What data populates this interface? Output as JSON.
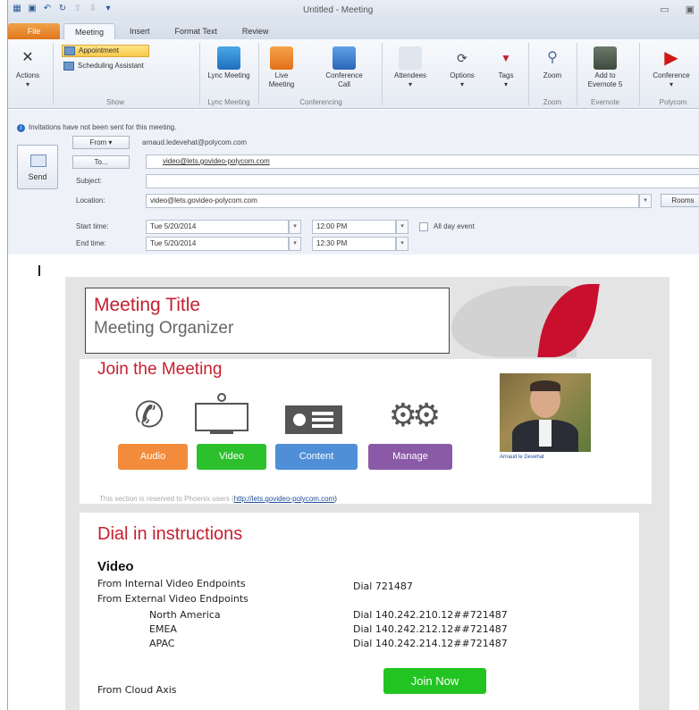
{
  "window": {
    "title": "Untitled - Meeting"
  },
  "tabs": [
    "File",
    "Meeting",
    "Insert",
    "Format Text",
    "Review"
  ],
  "ribbon": {
    "actions_label": "Actions",
    "appointment_label": "Appointment",
    "scheduling_label": "Scheduling Assistant",
    "show_group": "Show",
    "lync_meeting_label": "Lync Meeting",
    "lync_group": "Lync Meeting",
    "live_meeting_label": "Live Meeting",
    "conference_call_label": "Conference Call",
    "conferencing_group": "Conferencing",
    "attendees_label": "Attendees",
    "options_label": "Options",
    "tags_label": "Tags",
    "zoom_label": "Zoom",
    "zoom_group": "Zoom",
    "evernote_label": "Add to Evernote 5",
    "evernote_group": "Evernote",
    "polycom_label": "Conference",
    "polycom_group": "Polycom"
  },
  "form": {
    "info_text": "Invitations have not been sent for this meeting.",
    "send_label": "Send",
    "from_label": "From",
    "from_value": "arnaud.ledevehat@polycom.com",
    "to_label": "To...",
    "to_value": "video@lets.govideo-polycom.com",
    "subject_label": "Subject:",
    "subject_value": "",
    "location_label": "Location:",
    "location_value": "video@lets.govideo-polycom.com",
    "rooms_label": "Rooms",
    "start_label": "Start time:",
    "start_date": "Tue 5/20/2014",
    "start_time": "12:00 PM",
    "end_label": "End time:",
    "end_date": "Tue 5/20/2014",
    "end_time": "12:30 PM",
    "allday_label": "All day event"
  },
  "body": {
    "meeting_title": "Meeting Title",
    "meeting_organizer": "Meeting Organizer",
    "join_heading": "Join the Meeting",
    "buttons": [
      {
        "label": "Audio",
        "color": "#f28c3c"
      },
      {
        "label": "Video",
        "color": "#2cc02c"
      },
      {
        "label": "Content",
        "color": "#4f8fd8"
      },
      {
        "label": "Manage",
        "color": "#8a5aa6"
      }
    ],
    "photo_caption": "Arnaud le Devehat",
    "reserved_text": "This section is reserved to Phoenix users (",
    "reserved_link": "http://lets.govideo-polycom.com",
    "reserved_end": ")",
    "dial_heading": "Dial in instructions",
    "video_heading": "Video",
    "internal_label": "From Internal Video Endpoints",
    "internal_dial": "Dial 721487",
    "external_label": "From External Video Endpoints",
    "regions": [
      {
        "name": "North America",
        "dial": "Dial 140.242.210.12##721487"
      },
      {
        "name": "EMEA",
        "dial": "Dial 140.242.212.12##721487"
      },
      {
        "name": "APAC",
        "dial": "Dial 140.242.214.12##721487"
      }
    ],
    "cloud_label": "From Cloud Axis",
    "join_now_label": "Join Now"
  }
}
